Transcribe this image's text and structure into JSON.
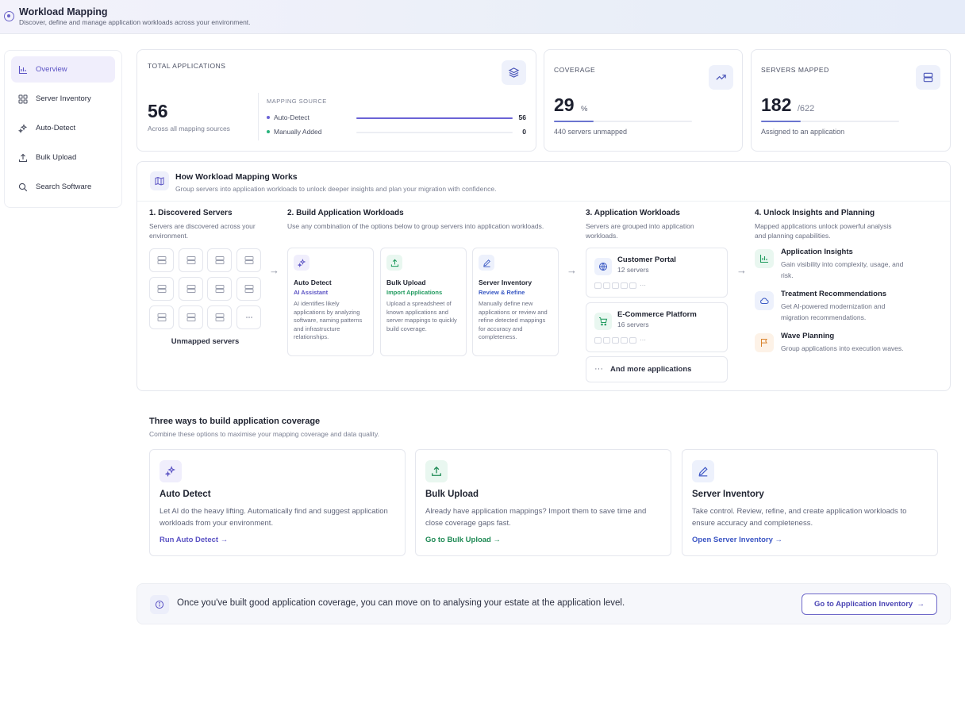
{
  "header": {
    "title": "Workload Mapping",
    "subtitle": "Discover, define and manage application workloads across your environment."
  },
  "sidebar": {
    "items": [
      {
        "label": "Overview",
        "icon": "bar-chart-icon",
        "active": true
      },
      {
        "label": "Server Inventory",
        "icon": "grid-icon",
        "active": false
      },
      {
        "label": "Auto-Detect",
        "icon": "sparkle-icon",
        "active": false
      },
      {
        "label": "Bulk Upload",
        "icon": "upload-icon",
        "active": false
      },
      {
        "label": "Search Software",
        "icon": "search-icon",
        "active": false
      }
    ]
  },
  "stats": {
    "total": {
      "label": "TOTAL APPLICATIONS",
      "value": "56",
      "caption": "Across all mapping sources",
      "source_label": "MAPPING SOURCE",
      "sources": [
        {
          "label": "Auto-Detect",
          "value": "56",
          "fraction": 1.0,
          "color": "#6b63d6"
        },
        {
          "label": "Manually Added",
          "value": "0",
          "fraction": 0.0,
          "color": "#29b37c"
        }
      ]
    },
    "coverage": {
      "label": "COVERAGE",
      "value": "29",
      "unit": "%",
      "caption": "440 servers unmapped",
      "fraction": 0.29
    },
    "servers": {
      "label": "SERVERS MAPPED",
      "value": "182",
      "total": "/622",
      "caption": "Assigned to an application",
      "fraction": 0.29
    }
  },
  "how": {
    "title": "How Workload Mapping Works",
    "subtitle": "Group servers into application workloads to unlock deeper insights and plan your migration with confidence.",
    "step1": {
      "title": "1. Discovered Servers",
      "desc": "Servers are discovered across your environment.",
      "caption": "Unmapped servers"
    },
    "step2": {
      "title": "2. Build Application Workloads",
      "desc": "Use any combination of the options below to group servers into application workloads.",
      "options": [
        {
          "title": "Auto Detect",
          "sub": "AI Assistant",
          "desc": "AI identifies likely applications by analyzing software, naming patterns and infrastructure relationships.",
          "color": "#5b53c4",
          "icon": "sparkle-icon"
        },
        {
          "title": "Bulk Upload",
          "sub": "Import Applications",
          "desc": "Upload a spreadsheet of known applications and server mappings to quickly build coverage.",
          "color": "#1f9a5e",
          "icon": "upload-icon"
        },
        {
          "title": "Server Inventory",
          "sub": "Review & Refine",
          "desc": "Manually define new applications or review and refine detected mappings for accuracy and completeness.",
          "color": "#3b5ac4",
          "icon": "pencil-icon"
        }
      ]
    },
    "step3": {
      "title": "3. Application Workloads",
      "desc": "Servers are grouped into application workloads.",
      "workloads": [
        {
          "name": "Customer Portal",
          "count": "12 servers",
          "icon": "globe-icon"
        },
        {
          "name": "E-Commerce Platform",
          "count": "16 servers",
          "icon": "cart-icon"
        }
      ],
      "more": "And more applications"
    },
    "step4": {
      "title": "4. Unlock Insights and Planning",
      "desc": "Mapped applications unlock powerful analysis and planning capabilities.",
      "items": [
        {
          "title": "Application Insights",
          "desc": "Gain visibility into complexity, usage, and risk.",
          "icon": "bar-chart-icon"
        },
        {
          "title": "Treatment Recommendations",
          "desc": "Get AI-powered modernization and migration recommendations.",
          "icon": "cloud-icon"
        },
        {
          "title": "Wave Planning",
          "desc": "Group applications into execution waves.",
          "icon": "flag-icon"
        }
      ]
    }
  },
  "ways": {
    "title": "Three ways to build application coverage",
    "subtitle": "Combine these options to maximise your mapping coverage and data quality.",
    "cards": [
      {
        "title": "Auto Detect",
        "desc": "Let AI do the heavy lifting. Automatically find and suggest application workloads from your environment.",
        "link": "Run Auto Detect",
        "color": "#5b53c4",
        "icon": "sparkle-icon"
      },
      {
        "title": "Bulk Upload",
        "desc": "Already have application mappings? Import them to save time and close coverage gaps fast.",
        "link": "Go to Bulk Upload",
        "color": "#1f8a55",
        "icon": "upload-icon"
      },
      {
        "title": "Server Inventory",
        "desc": "Take control. Review, refine, and create application workloads to ensure accuracy and completeness.",
        "link": "Open Server Inventory",
        "color": "#3b55c4",
        "icon": "pencil-icon"
      }
    ]
  },
  "banner": {
    "text": "Once you've built good application coverage, you can move on to analysing your estate at the application level.",
    "button": "Go to Application Inventory"
  }
}
